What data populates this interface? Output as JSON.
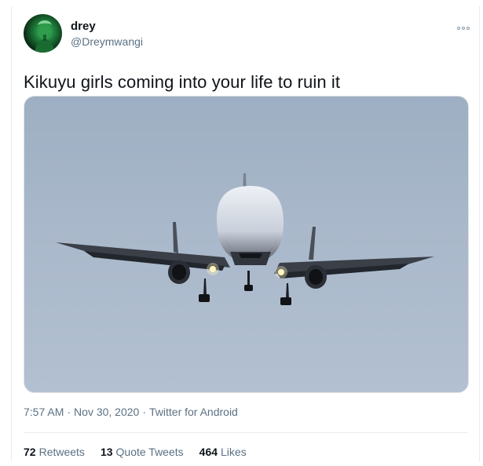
{
  "user": {
    "display_name": "drey",
    "handle": "@Dreymwangi",
    "avatar_icon": "profile-avatar"
  },
  "more_icon": "more-dots-icon",
  "tweet": {
    "text": "Kikuyu girls coming into your life to ruin it",
    "media_icon": "airplane-photo"
  },
  "meta": {
    "time": "7:57 AM",
    "separator": "·",
    "date": "Nov 30, 2020",
    "source": "Twitter for Android"
  },
  "stats": {
    "retweets_count": "72",
    "retweets_label": "Retweets",
    "quotes_count": "13",
    "quotes_label": "Quote Tweets",
    "likes_count": "464",
    "likes_label": "Likes"
  },
  "colors": {
    "text_primary": "#0f1419",
    "text_secondary": "#5b7083",
    "border": "#e6ecf0"
  }
}
